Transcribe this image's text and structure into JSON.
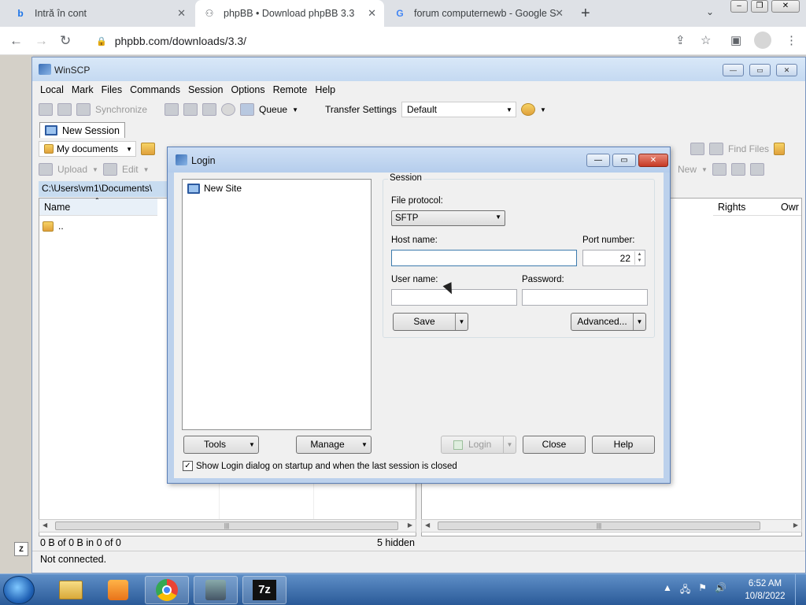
{
  "browser": {
    "tabs": [
      {
        "title": "Intră în cont",
        "icon": "bing-icon"
      },
      {
        "title": "phpBB • Download phpBB 3.3",
        "icon": "phpbb-icon"
      },
      {
        "title": "forum computernewb - Google S",
        "icon": "google-icon"
      }
    ],
    "url": "phpbb.com/downloads/3.3/"
  },
  "winscp": {
    "title": "WinSCP",
    "menu": [
      "Local",
      "Mark",
      "Files",
      "Commands",
      "Session",
      "Options",
      "Remote",
      "Help"
    ],
    "toolbar": {
      "synchronize": "Synchronize",
      "queue": "Queue",
      "transfer_settings_label": "Transfer Settings",
      "transfer_settings_value": "Default"
    },
    "session_tab": "New Session",
    "local": {
      "location": "My documents",
      "upload": "Upload",
      "edit": "Edit",
      "path": "C:\\Users\\vm1\\Documents\\",
      "column_name": "Name",
      "parent_dir": ".."
    },
    "remote": {
      "find_files": "Find Files",
      "new": "New",
      "col_rights": "Rights",
      "col_owner": "Owr"
    },
    "status": {
      "selection": "0 B of 0 B in 0 of 0",
      "hidden": "5 hidden",
      "connection": "Not connected."
    }
  },
  "login": {
    "title": "Login",
    "site": "New Site",
    "session_group": "Session",
    "file_protocol_label": "File protocol:",
    "file_protocol_value": "SFTP",
    "host_label": "Host name:",
    "host_value": "",
    "port_label": "Port number:",
    "port_value": "22",
    "user_label": "User name:",
    "user_value": "",
    "password_label": "Password:",
    "password_value": "",
    "save": "Save",
    "advanced": "Advanced...",
    "tools": "Tools",
    "manage": "Manage",
    "login_btn": "Login",
    "close_btn": "Close",
    "help_btn": "Help",
    "show_login_checkbox": "Show Login dialog on startup and when the last session is closed",
    "show_login_checked": true
  },
  "taskbar": {
    "time": "6:52 AM",
    "date": "10/8/2022"
  },
  "colors": {
    "accent": "#2a5a98",
    "panel_path": "#c8dcf0",
    "close_button": "#c63a25"
  }
}
